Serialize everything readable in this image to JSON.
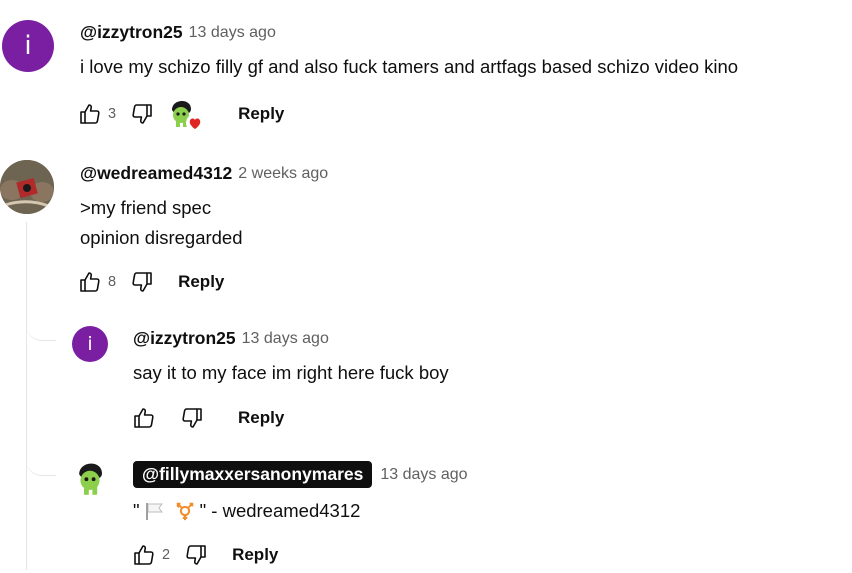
{
  "comments": [
    {
      "author": "@izzytron25",
      "time": "13 days ago",
      "avatar_letter": "i",
      "lines": [
        "i love my schizo filly gf and also fuck tamers and artfags based schizo video kino"
      ],
      "likes": "3",
      "reply_label": "Reply",
      "creator_heart": true
    },
    {
      "author": "@wedreamed4312",
      "time": "2 weeks ago",
      "lines": [
        ">my friend spec",
        "opinion disregarded"
      ],
      "likes": "8",
      "reply_label": "Reply"
    },
    {
      "author": "@izzytron25",
      "time": "13 days ago",
      "avatar_letter": "i",
      "lines": [
        "say it to my face im right here fuck boy"
      ],
      "likes": "",
      "reply_label": "Reply"
    },
    {
      "author": "@fillymaxxersanonymares",
      "time": "13 days ago",
      "quote_open": "\"",
      "quote_close": "\" - wedreamed4312",
      "likes": "2",
      "reply_label": "Reply"
    }
  ],
  "colors": {
    "letter_avatar": "#7b1fa2",
    "heart": "#e02424",
    "pony": "#8ccf4d"
  },
  "icons": [
    "thumbs-up-icon",
    "thumbs-down-icon",
    "creator-heart-icon",
    "white-flag-icon",
    "transgender-symbol-icon"
  ]
}
